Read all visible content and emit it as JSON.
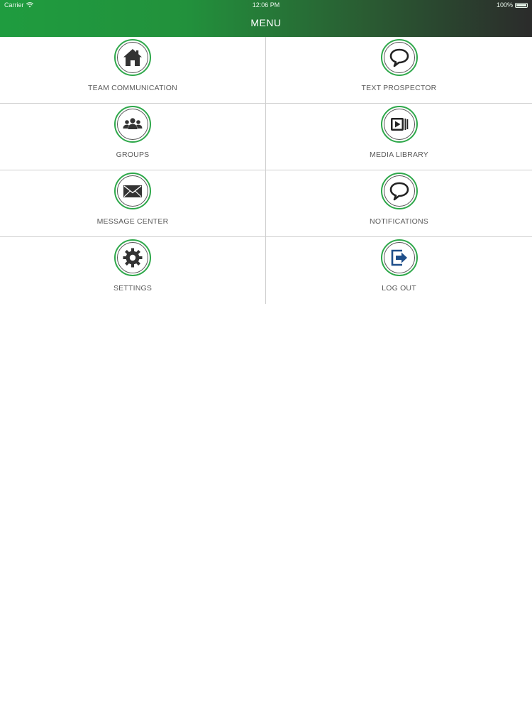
{
  "status_bar": {
    "carrier": "Carrier",
    "time": "12:06 PM",
    "battery": "100%"
  },
  "header": {
    "title": "MENU"
  },
  "menu": {
    "items": [
      {
        "label": "TEAM COMMUNICATION",
        "icon": "home-icon"
      },
      {
        "label": "TEXT PROSPECTOR",
        "icon": "speech-bubble-icon"
      },
      {
        "label": "GROUPS",
        "icon": "people-icon"
      },
      {
        "label": "MEDIA LIBRARY",
        "icon": "media-play-icon"
      },
      {
        "label": "MESSAGE CENTER",
        "icon": "envelope-icon"
      },
      {
        "label": "NOTIFICATIONS",
        "icon": "speech-bubble-icon"
      },
      {
        "label": "SETTINGS",
        "icon": "gear-icon"
      },
      {
        "label": "LOG OUT",
        "icon": "logout-icon"
      }
    ]
  },
  "colors": {
    "header_start": "#1f9c3f",
    "header_end": "#2b2b2b",
    "ring": "#2ea84a",
    "logout_icon": "#1f4f8a"
  }
}
